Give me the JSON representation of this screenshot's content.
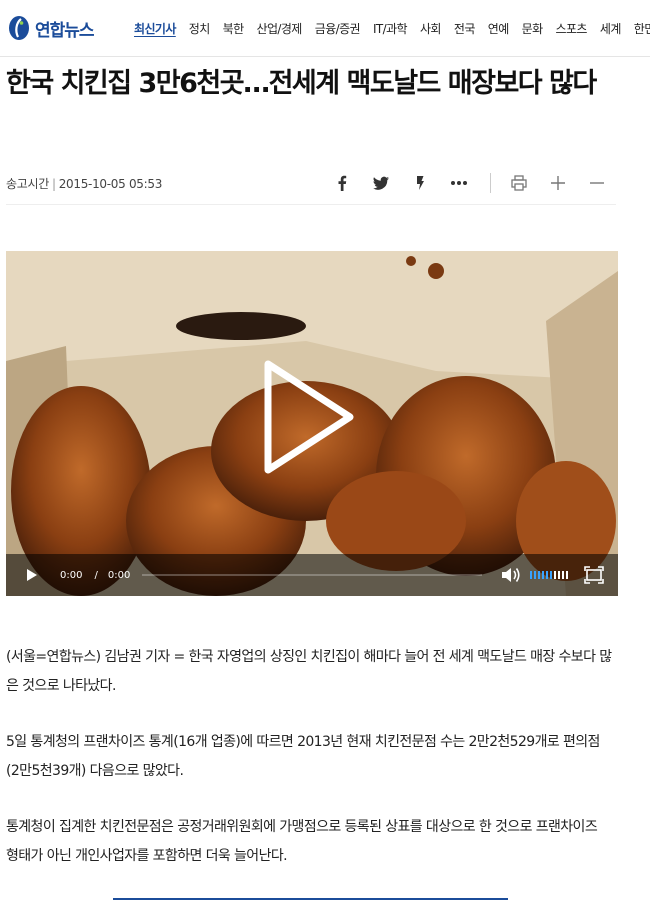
{
  "header": {
    "logo_text": "연합뉴스",
    "nav": [
      "최신기사",
      "정치",
      "북한",
      "산업/경제",
      "금융/증권",
      "IT/과학",
      "사회",
      "전국",
      "연예",
      "문화",
      "스포츠",
      "세계",
      "한민"
    ]
  },
  "article": {
    "title": "한국 치킨집 3만6천곳…전세계 맥도날드 매장보다 많다",
    "meta_label": "송고시간",
    "meta_datetime": "2015-10-05 05:53",
    "paragraphs": [
      "(서울=연합뉴스) 김남권 기자 = 한국 자영업의 상징인 치킨집이 해마다 늘어 전 세계 맥도날드 매장 수보다 많은 것으로 나타났다.",
      "5일 통계청의 프랜차이즈 통계(16개 업종)에 따르면 2013년 현재 치킨전문점 수는 2만2천529개로 편의점(2만5천39개) 다음으로 많았다.",
      "통계청이 집계한 치킨전문점은 공정거래위원회에 가맹점으로 등록된 상표를 대상으로 한 것으로 프랜차이즈 형태가 아닌 개인사업자를 포함하면 더욱 늘어난다."
    ]
  },
  "share_icons": [
    "facebook-icon",
    "twitter-icon",
    "kakaostory-icon",
    "more-icon",
    "print-icon",
    "font-larger-icon",
    "font-smaller-icon"
  ],
  "video": {
    "current_time": "0:00",
    "separator": "/",
    "duration": "0:00",
    "volume_level_fraction": 0.6
  },
  "colors": {
    "brand": "#1b4c9a",
    "volume": "#3aa3ff"
  }
}
